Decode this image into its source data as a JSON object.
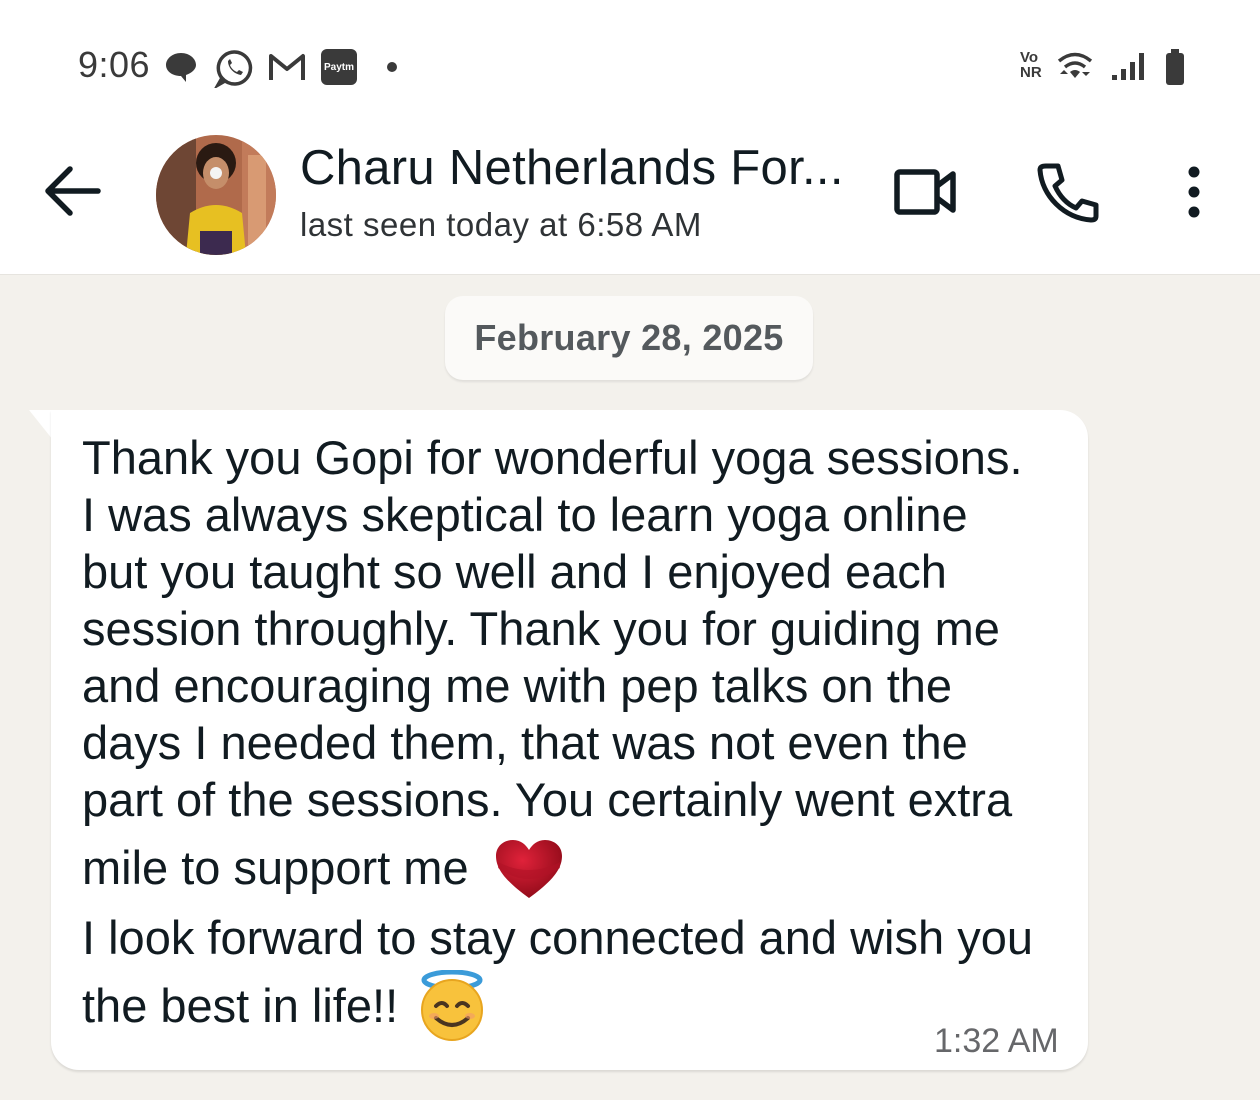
{
  "status_bar": {
    "time": "9:06",
    "left_icons": [
      "chat-bubble-icon",
      "whatsapp-icon",
      "gmail-icon",
      "paytm-icon",
      "notification-dot-icon"
    ],
    "paytm_label": "Paytm",
    "network_label_top": "Vo",
    "network_label_bottom": "NR",
    "right_icons": [
      "vonr-icon",
      "wifi-icon",
      "signal-icon",
      "battery-icon"
    ]
  },
  "header": {
    "contact_name": "Charu Netherlands For...",
    "last_seen": "last seen today at 6:58 AM",
    "actions": [
      "video-call-icon",
      "voice-call-icon",
      "more-options-icon"
    ]
  },
  "chat": {
    "date_divider": "February 28, 2025",
    "message": {
      "lines": [
        "Thank you Gopi for wonderful yoga sessions.",
        "I was always skeptical to learn yoga online",
        "but you taught so well and I enjoyed each",
        "session throughly. Thank you for guiding me",
        "and encouraging me with pep talks on the",
        "days I needed them, that was not even the",
        "part of the sessions. You certainly went extra",
        "mile to support me",
        "I look forward to stay connected and wish you",
        "the best in life!!"
      ],
      "emojis": [
        "red-heart-emoji",
        "smiling-face-with-halo-emoji"
      ],
      "time": "1:32 AM"
    }
  },
  "colors": {
    "chat_background": "#f3f1ec",
    "bubble": "#ffffff",
    "header": "#ffffff",
    "text": "#111b21"
  }
}
